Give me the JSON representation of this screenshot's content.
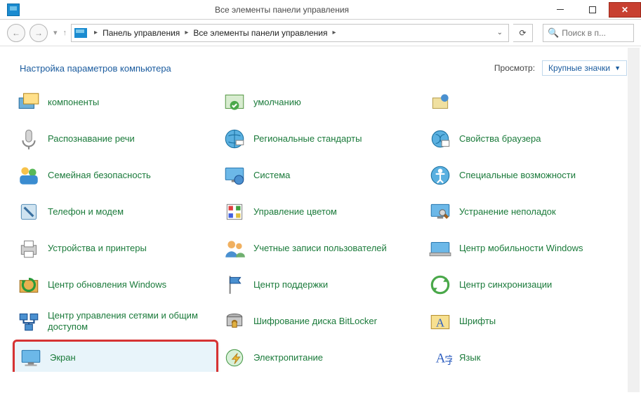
{
  "window": {
    "title": "Все элементы панели управления"
  },
  "nav": {
    "breadcrumb": [
      "Панель управления",
      "Все элементы панели управления"
    ],
    "search_placeholder": "Поиск в п..."
  },
  "header": {
    "title": "Настройка параметров компьютера",
    "view_label": "Просмотр:",
    "view_value": "Крупные значки"
  },
  "cols": {
    "c1": [
      {
        "label": "компоненты",
        "icon": "components"
      },
      {
        "label": "Распознавание речи",
        "icon": "mic"
      },
      {
        "label": "Семейная безопасность",
        "icon": "family"
      },
      {
        "label": "Телефон и модем",
        "icon": "phone"
      },
      {
        "label": "Устройства и принтеры",
        "icon": "printer"
      },
      {
        "label": "Центр обновления Windows",
        "icon": "update"
      },
      {
        "label": "Центр управления сетями и общим доступом",
        "icon": "network"
      },
      {
        "label": "Экран",
        "icon": "display",
        "highlight": true
      }
    ],
    "c2": [
      {
        "label": "умолчанию",
        "icon": "defaults"
      },
      {
        "label": "Региональные стандарты",
        "icon": "region"
      },
      {
        "label": "Система",
        "icon": "system"
      },
      {
        "label": "Управление цветом",
        "icon": "color"
      },
      {
        "label": "Учетные записи пользователей",
        "icon": "users"
      },
      {
        "label": "Центр поддержки",
        "icon": "flag"
      },
      {
        "label": "Шифрование диска BitLocker",
        "icon": "bitlocker"
      },
      {
        "label": "Электропитание",
        "icon": "power"
      }
    ],
    "c3": [
      {
        "label": "",
        "icon": "partialrow"
      },
      {
        "label": "Свойства браузера",
        "icon": "browser"
      },
      {
        "label": "Специальные возможности",
        "icon": "access"
      },
      {
        "label": "Устранение неполадок",
        "icon": "trouble"
      },
      {
        "label": "Центр мобильности Windows",
        "icon": "mobility"
      },
      {
        "label": "Центр синхронизации",
        "icon": "sync"
      },
      {
        "label": "Шрифты",
        "icon": "fonts"
      },
      {
        "label": "Язык",
        "icon": "lang"
      }
    ]
  }
}
